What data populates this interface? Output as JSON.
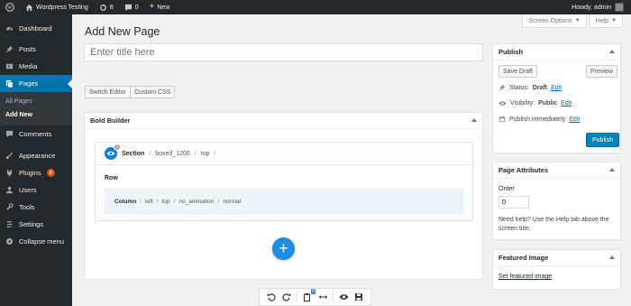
{
  "adminbar": {
    "site_name": "Wordpress Testing",
    "updates_count": "8",
    "comments_count": "0",
    "new_label": "New",
    "greeting": "Howdy, admin"
  },
  "sidebar": {
    "items": [
      {
        "label": "Dashboard",
        "icon": "dashboard-icon"
      },
      {
        "label": "Posts",
        "icon": "pin-icon"
      },
      {
        "label": "Media",
        "icon": "media-icon"
      },
      {
        "label": "Pages",
        "icon": "pages-icon"
      },
      {
        "label": "Comments",
        "icon": "comments-icon"
      },
      {
        "label": "Appearance",
        "icon": "brush-icon"
      },
      {
        "label": "Plugins",
        "icon": "plugin-icon"
      },
      {
        "label": "Users",
        "icon": "users-icon"
      },
      {
        "label": "Tools",
        "icon": "wrench-icon"
      },
      {
        "label": "Settings",
        "icon": "settings-icon"
      },
      {
        "label": "Collapse menu",
        "icon": "collapse-icon"
      }
    ],
    "sub_items": [
      "All Pages",
      "Add New"
    ],
    "plugins_badge": "8"
  },
  "screen_options": {
    "label": "Screen Options",
    "help": "Help"
  },
  "page": {
    "title": "Add New Page",
    "title_placeholder": "Enter title here",
    "switch_editor": "Switch Editor",
    "custom_css": "Custom CSS"
  },
  "builder": {
    "box_title": "Bold Builder",
    "section": {
      "badge": "1",
      "label": "Section",
      "attrs": [
        "boxed_1200",
        "top"
      ]
    },
    "row_label": "Row",
    "column": {
      "label": "Column",
      "attrs": [
        "left",
        "top",
        "no_animation",
        "normal"
      ]
    },
    "toolbar_badge": "0"
  },
  "publish": {
    "title": "Publish",
    "save_draft": "Save Draft",
    "preview": "Preview",
    "status_label": "Status:",
    "status_value": "Draft",
    "visibility_label": "Visibility:",
    "visibility_value": "Public",
    "publish_immediately": "Publish immediately",
    "edit": "Edit",
    "publish_button": "Publish"
  },
  "attributes": {
    "title": "Page Attributes",
    "order_label": "Order",
    "order_value": "0",
    "help_text": "Need help? Use the Help tab above the screen title."
  },
  "featured": {
    "title": "Featured Image",
    "link": "Set featured image"
  },
  "colors": {
    "accent": "#0073aa",
    "builder_blue": "#1c8ee6",
    "admin_dark": "#23282d"
  }
}
